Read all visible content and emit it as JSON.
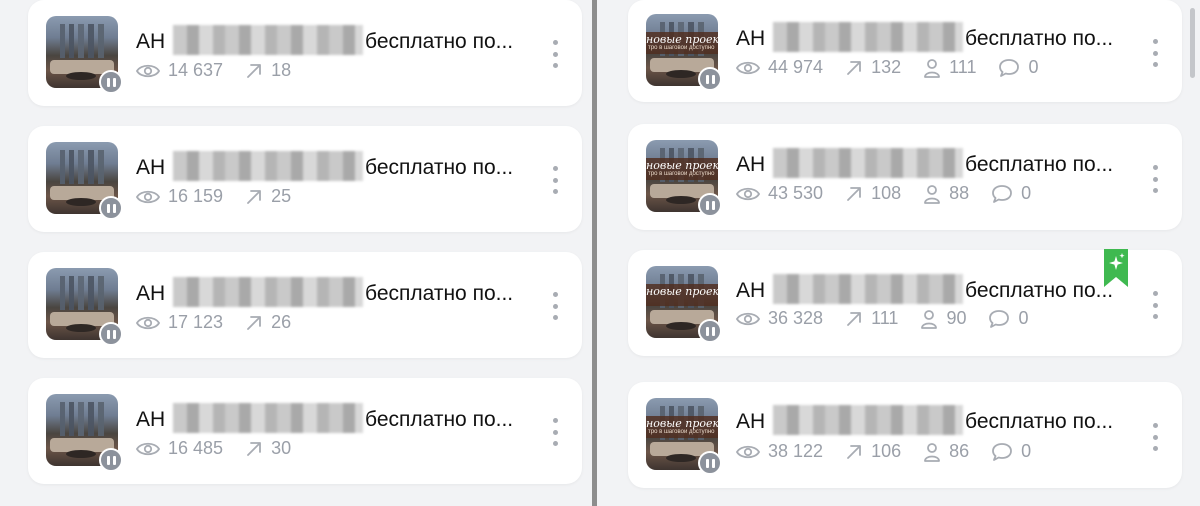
{
  "colors": {
    "stat_text": "#9a9fa8",
    "bookmark": "#3fb950",
    "divider": "#8d8d8d"
  },
  "left_cards": [
    {
      "title_prefix": "АН",
      "title_suffix": "бесплатно по...",
      "views": "14 637",
      "reposts": "18"
    },
    {
      "title_prefix": "АН",
      "title_suffix": "бесплатно по...",
      "views": "16 159",
      "reposts": "25"
    },
    {
      "title_prefix": "АН",
      "title_suffix": "бесплатно по...",
      "views": "17 123",
      "reposts": "26"
    },
    {
      "title_prefix": "АН",
      "title_suffix": "бесплатно по...",
      "views": "16 485",
      "reposts": "30"
    }
  ],
  "right_cards": [
    {
      "title_prefix": "АН",
      "title_suffix": "бесплатно по...",
      "views": "44 974",
      "reposts": "132",
      "members": "111",
      "comments": "0",
      "thumb_text_1": "новые проект",
      "thumb_text_2": "тро в шаговой доступно"
    },
    {
      "title_prefix": "АН",
      "title_suffix": "бесплатно по...",
      "views": "43 530",
      "reposts": "108",
      "members": "88",
      "comments": "0",
      "thumb_text_1": "новые проект",
      "thumb_text_2": "тро в шаговой доступно"
    },
    {
      "title_prefix": "АН",
      "title_suffix": "бесплатно по...",
      "views": "36 328",
      "reposts": "111",
      "members": "90",
      "comments": "0",
      "thumb_text_1": "новые проект",
      "thumb_text_2": ""
    },
    {
      "title_prefix": "АН",
      "title_suffix": "бесплатно по...",
      "views": "38 122",
      "reposts": "106",
      "members": "86",
      "comments": "0",
      "thumb_text_1": "новые проект",
      "thumb_text_2": "тро в шаговой доступно"
    }
  ],
  "icons": {
    "views": "eye-icon",
    "reposts": "arrow-up-right-icon",
    "members": "person-icon",
    "comments": "comment-icon",
    "status": "pause-icon",
    "menu": "kebab-menu-icon",
    "bookmark": "bookmark-sparkle-icon"
  }
}
